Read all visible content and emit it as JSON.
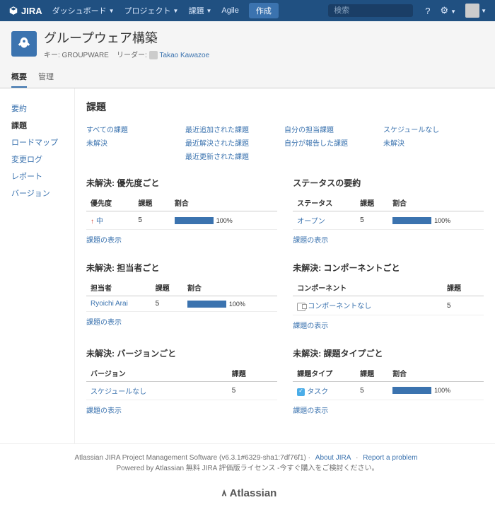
{
  "nav": {
    "brand": "JIRA",
    "items": [
      "ダッシュボード",
      "プロジェクト",
      "課題",
      "Agile"
    ],
    "create": "作成",
    "search_placeholder": "検索"
  },
  "project": {
    "title": "グループウェア構築",
    "key_label": "キー: GROUPWARE",
    "leader_label": "リーダー:",
    "leader_name": "Takao Kawazoe"
  },
  "tabs": [
    "概要",
    "管理"
  ],
  "sidebar": [
    "要約",
    "課題",
    "ロードマップ",
    "変更ログ",
    "レポート",
    "バージョン"
  ],
  "heading": "課題",
  "filters": {
    "col1": [
      "すべての課題",
      "未解決"
    ],
    "col2": [
      "最近追加された課題",
      "最近解決された課題",
      "最近更新された課題"
    ],
    "col3": [
      "自分の担当課題",
      "自分が報告した課題"
    ],
    "col4": [
      "スケジュールなし",
      "未解決"
    ]
  },
  "panels": {
    "priority": {
      "title": "未解決: 優先度ごと",
      "cols": [
        "優先度",
        "課題",
        "割合"
      ],
      "row": {
        "label": "中",
        "count": 5,
        "pct": "100%"
      },
      "more": "課題の表示"
    },
    "status": {
      "title": "ステータスの要約",
      "cols": [
        "ステータス",
        "課題",
        "割合"
      ],
      "row": {
        "label": "オープン",
        "count": 5,
        "pct": "100%"
      },
      "more": "課題の表示"
    },
    "assignee": {
      "title": "未解決: 担当者ごと",
      "cols": [
        "担当者",
        "課題",
        "割合"
      ],
      "row": {
        "label": "Ryoichi Arai",
        "count": 5,
        "pct": "100%"
      },
      "more": "課題の表示"
    },
    "component": {
      "title": "未解決: コンポーネントごと",
      "cols": [
        "コンポーネント",
        "課題"
      ],
      "row": {
        "label": "コンポーネントなし",
        "count": 5
      },
      "more": "課題の表示"
    },
    "version": {
      "title": "未解決: バージョンごと",
      "cols": [
        "バージョン",
        "課題"
      ],
      "row": {
        "label": "スケジュールなし",
        "count": 5
      },
      "more": "課題の表示"
    },
    "issuetype": {
      "title": "未解決: 課題タイプごと",
      "cols": [
        "課題タイプ",
        "課題",
        "割合"
      ],
      "row": {
        "label": "タスク",
        "count": 5,
        "pct": "100%"
      },
      "more": "課題の表示"
    }
  },
  "footer": {
    "line1a": "Atlassian JIRA Project Management Software",
    "line1b": "(v6.3.1#6329-sha1:7df76f1)",
    "about": "About JIRA",
    "report": "Report a problem",
    "line2": "Powered by Atlassian 無料 JIRA 評価版ライセンス -今すぐ購入をご検討ください。",
    "brand": "Atlassian"
  }
}
